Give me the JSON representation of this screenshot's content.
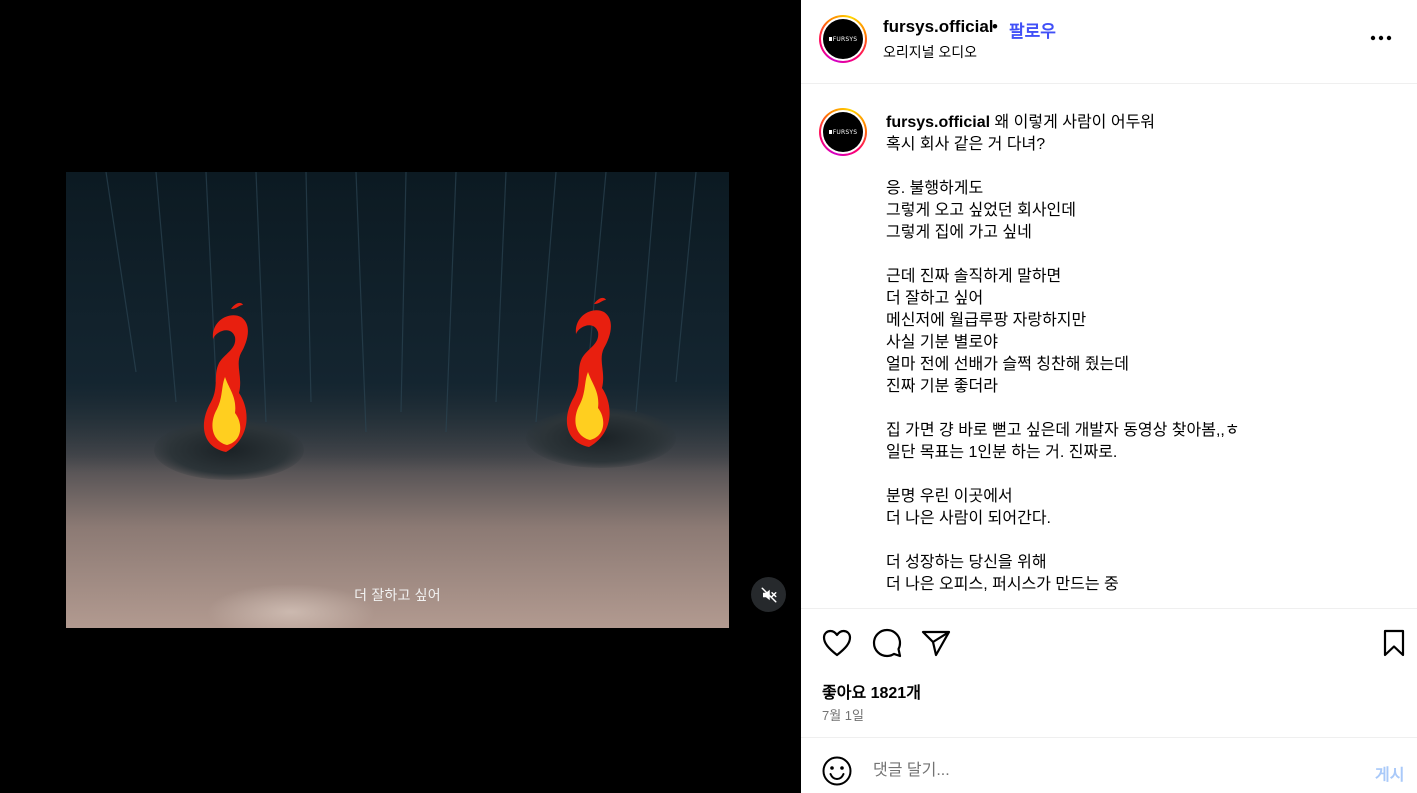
{
  "media": {
    "subtitle": "더 잘하고 싶어"
  },
  "header": {
    "username": "fursys.official",
    "separator": "•",
    "follow_label": "팔로우",
    "audio_label": "오리지널 오디오",
    "avatar_text": "FURSYS"
  },
  "caption": {
    "username": "fursys.official",
    "text": " 왜 이렇게 사람이 어두워\n혹시 회사 같은 거 다녀?\n\n응. 불행하게도\n그렇게 오고 싶었던 회사인데\n그렇게 집에 가고 싶네\n\n근데 진짜 솔직하게 말하면\n더 잘하고 싶어\n메신저에 월급루팡 자랑하지만\n사실 기분 별로야\n얼마 전에 선배가 슬쩍 칭찬해 줬는데\n진짜 기분 좋더라\n\n집 가면 걍 바로 뻗고 싶은데 개발자 동영상 찾아봄,,ㅎ\n일단 목표는 1인분 하는 거. 진짜로.\n\n분명 우린 이곳에서\n더 나은 사람이 되어간다.\n\n더 성장하는 당신을 위해\n더 나은 오피스, 퍼시스가 만드는 중"
  },
  "engagement": {
    "likes_label": "좋아요 1821개",
    "date": "7월 1일"
  },
  "comment": {
    "placeholder": "댓글 달기...",
    "post_label": "게시"
  },
  "icons": {
    "like": "heart-icon",
    "comment": "comment-icon",
    "share": "send-icon",
    "save": "bookmark-icon",
    "more": "more-icon",
    "mute": "speaker-muted-icon",
    "emoji": "emoji-icon"
  },
  "colors": {
    "follow": "#4150f7",
    "post_button": "#a9c9f9",
    "secondary_text": "#737373"
  }
}
